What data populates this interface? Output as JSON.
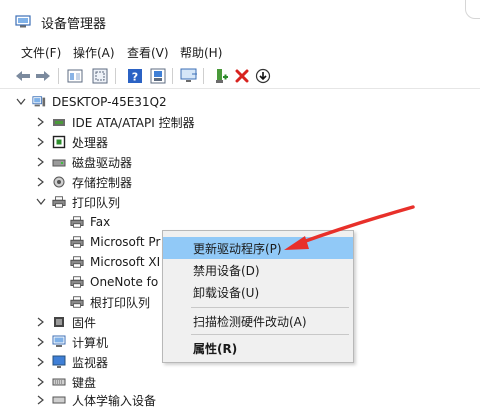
{
  "window": {
    "title": "设备管理器"
  },
  "menu": [
    {
      "label": "文件(F)"
    },
    {
      "label": "操作(A)"
    },
    {
      "label": "查看(V)"
    },
    {
      "label": "帮助(H)"
    }
  ],
  "toolbar": [
    {
      "name": "back-icon"
    },
    {
      "name": "forward-icon"
    },
    {
      "name": "properties-icon"
    },
    {
      "name": "show-hidden-icon"
    },
    {
      "name": "help-icon"
    },
    {
      "name": "device-view-icon"
    },
    {
      "name": "scan-monitor-icon"
    },
    {
      "name": "add-driver-icon"
    },
    {
      "name": "uninstall-x-icon"
    },
    {
      "name": "download-driver-icon"
    }
  ],
  "tree": {
    "root": "DESKTOP-45E31Q2",
    "items": [
      {
        "label": "IDE ATA/ATAPI 控制器",
        "icon": "ide-controller-icon"
      },
      {
        "label": "处理器",
        "icon": "processor-icon"
      },
      {
        "label": "磁盘驱动器",
        "icon": "disk-drive-icon"
      },
      {
        "label": "存储控制器",
        "icon": "storage-controller-icon"
      },
      {
        "label": "打印队列",
        "icon": "print-queue-icon"
      },
      {
        "label": "Fax",
        "icon": "printer-icon"
      },
      {
        "label": "Microsoft Pr",
        "icon": "printer-icon"
      },
      {
        "label": "Microsoft XI",
        "icon": "printer-icon"
      },
      {
        "label": "OneNote fo",
        "icon": "printer-icon"
      },
      {
        "label": "根打印队列",
        "icon": "printer-icon"
      },
      {
        "label": "固件",
        "icon": "firmware-icon"
      },
      {
        "label": "计算机",
        "icon": "computer-icon"
      },
      {
        "label": "监视器",
        "icon": "monitor-icon"
      },
      {
        "label": "键盘",
        "icon": "keyboard-icon"
      },
      {
        "label": "人体学输入设备",
        "icon": "hid-icon"
      }
    ]
  },
  "context_menu": {
    "update_driver": "更新驱动程序(P)",
    "disable_device": "禁用设备(D)",
    "uninstall_device": "卸载设备(U)",
    "scan_hardware": "扫描检测硬件改动(A)",
    "properties": "属性(R)"
  },
  "colors": {
    "highlight": "#91c9f7",
    "arrow": "#e8302a"
  }
}
